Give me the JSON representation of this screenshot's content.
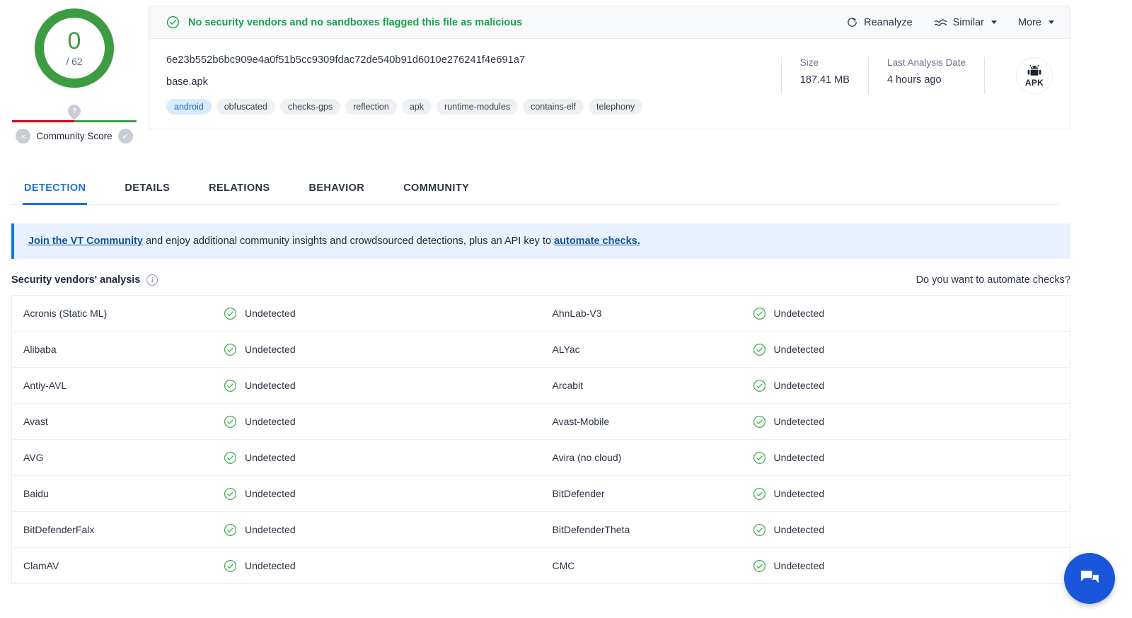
{
  "score": {
    "value": "0",
    "total": "/ 62",
    "community_label": "Community Score",
    "pin_glyph": "?",
    "negative_glyph": "×",
    "positive_glyph": "✓",
    "ring_color": "#3d9c41"
  },
  "header": {
    "verdict": "No security vendors and no sandboxes flagged this file as malicious",
    "verdict_color": "#16a34a",
    "actions": [
      {
        "label": "Reanalyze",
        "icon": "reanalyze-icon",
        "caret": false
      },
      {
        "label": "Similar",
        "icon": "similar-icon",
        "caret": true
      },
      {
        "label": "More",
        "icon": "",
        "caret": true
      }
    ],
    "file_hash": "6e23b552b6bc909e4a0f51b5cc9309fdac72de540b91d6010e276241f4e691a7",
    "file_name": "base.apk",
    "tags": [
      {
        "label": "android",
        "highlight": true
      },
      {
        "label": "obfuscated",
        "highlight": false
      },
      {
        "label": "checks-gps",
        "highlight": false
      },
      {
        "label": "reflection",
        "highlight": false
      },
      {
        "label": "apk",
        "highlight": false
      },
      {
        "label": "runtime-modules",
        "highlight": false
      },
      {
        "label": "contains-elf",
        "highlight": false
      },
      {
        "label": "telephony",
        "highlight": false
      }
    ],
    "meta": [
      {
        "label": "Size",
        "value": "187.41 MB"
      },
      {
        "label": "Last Analysis Date",
        "value": "4 hours ago"
      }
    ],
    "file_type_badge": "APK"
  },
  "tabs": [
    {
      "label": "DETECTION",
      "active": true
    },
    {
      "label": "DETAILS",
      "active": false
    },
    {
      "label": "RELATIONS",
      "active": false
    },
    {
      "label": "BEHAVIOR",
      "active": false
    },
    {
      "label": "COMMUNITY",
      "active": false
    }
  ],
  "banner": {
    "link1": "Join the VT Community",
    "middle": " and enjoy additional community insights and crowdsourced detections, plus an API key to ",
    "link2": "automate checks.",
    "accent": "#1a73e8"
  },
  "vendors_section": {
    "title": "Security vendors' analysis",
    "info_glyph": "i",
    "automate_link": "Do you want to automate checks?"
  },
  "vendor_rows": [
    [
      {
        "name": "Acronis (Static ML)",
        "status": "Undetected"
      },
      {
        "name": "AhnLab-V3",
        "status": "Undetected"
      }
    ],
    [
      {
        "name": "Alibaba",
        "status": "Undetected"
      },
      {
        "name": "ALYac",
        "status": "Undetected"
      }
    ],
    [
      {
        "name": "Antiy-AVL",
        "status": "Undetected"
      },
      {
        "name": "Arcabit",
        "status": "Undetected"
      }
    ],
    [
      {
        "name": "Avast",
        "status": "Undetected"
      },
      {
        "name": "Avast-Mobile",
        "status": "Undetected"
      }
    ],
    [
      {
        "name": "AVG",
        "status": "Undetected"
      },
      {
        "name": "Avira (no cloud)",
        "status": "Undetected"
      }
    ],
    [
      {
        "name": "Baidu",
        "status": "Undetected"
      },
      {
        "name": "BitDefender",
        "status": "Undetected"
      }
    ],
    [
      {
        "name": "BitDefenderFalx",
        "status": "Undetected"
      },
      {
        "name": "BitDefenderTheta",
        "status": "Undetected"
      }
    ],
    [
      {
        "name": "ClamAV",
        "status": "Undetected"
      },
      {
        "name": "CMC",
        "status": "Undetected"
      }
    ]
  ],
  "chat": {
    "icon": "chat-bubbles-icon",
    "color": "#1a56db"
  }
}
